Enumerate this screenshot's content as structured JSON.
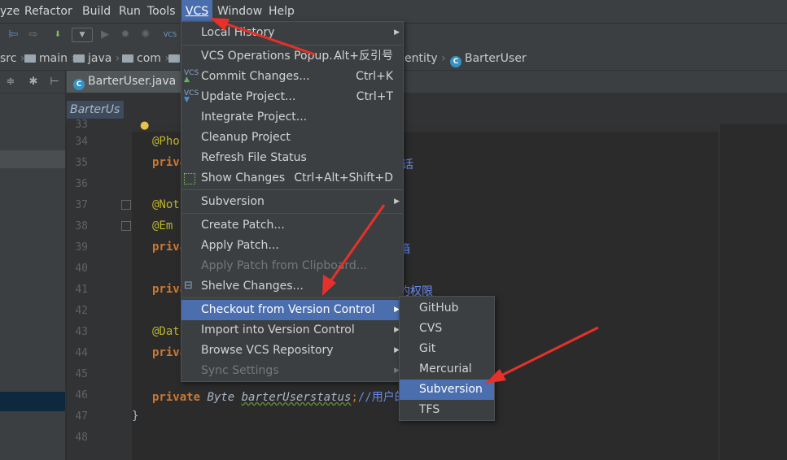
{
  "menubar": {
    "items": [
      "yze",
      "Refactor",
      "Build",
      "Run",
      "Tools",
      "VCS",
      "Window",
      "Help"
    ],
    "active": "VCS"
  },
  "navbar": {
    "crumbs": [
      "src",
      "main",
      "java",
      "com",
      "entity",
      "BarterUser"
    ]
  },
  "editor": {
    "tab_label": "BarterUser.java",
    "breadcrumb_label": "BarterUs",
    "line_numbers": [
      "33",
      "34",
      "35",
      "36",
      "37",
      "38",
      "39",
      "40",
      "41",
      "42",
      "43",
      "44",
      "45",
      "46",
      "47",
      "48"
    ],
    "code": {
      "l34": "@Pho",
      "l35_kw": "priva",
      "l35_tail": "话",
      "l37": "@Not",
      "l38": "@Em",
      "l39_kw": "priva",
      "l39_tail": "箱",
      "l41_kw": "priva",
      "l41_tail": "的权限",
      "l43": "@Dat",
      "l44_kw": "priva",
      "l46_kw": "private",
      "l46_type": "Byte",
      "l46_var": "barterUserstatus",
      "l46_semi": ";",
      "l46_comment": "//用户的状态",
      "l47": "}"
    }
  },
  "vcs_menu": {
    "items": [
      {
        "label": "Local History",
        "shortcut": "",
        "submenu": true
      },
      {
        "label": "VCS Operations Popup...",
        "shortcut": "Alt+反引号"
      },
      {
        "label": "Commit Changes...",
        "shortcut": "Ctrl+K",
        "icon": "vcs-commit-icon"
      },
      {
        "label": "Update Project...",
        "shortcut": "Ctrl+T",
        "icon": "vcs-update-icon"
      },
      {
        "label": "Integrate Project...",
        "shortcut": ""
      },
      {
        "label": "Cleanup Project",
        "shortcut": ""
      },
      {
        "label": "Refresh File Status",
        "shortcut": ""
      },
      {
        "label": "Show Changes",
        "shortcut": "Ctrl+Alt+Shift+D",
        "icon": "show-changes-icon"
      },
      {
        "label": "Subversion",
        "shortcut": "",
        "submenu": true
      },
      {
        "label": "Create Patch...",
        "shortcut": ""
      },
      {
        "label": "Apply Patch...",
        "shortcut": ""
      },
      {
        "label": "Apply Patch from Clipboard...",
        "shortcut": "",
        "disabled": true
      },
      {
        "label": "Shelve Changes...",
        "shortcut": "",
        "icon": "shelve-icon"
      },
      {
        "label": "Checkout from Version Control",
        "shortcut": "",
        "submenu": true,
        "selected": true
      },
      {
        "label": "Import into Version Control",
        "shortcut": "",
        "submenu": true
      },
      {
        "label": "Browse VCS Repository",
        "shortcut": "",
        "submenu": true
      },
      {
        "label": "Sync Settings",
        "shortcut": "",
        "submenu": true,
        "disabled": true
      }
    ]
  },
  "checkout_submenu": {
    "items": [
      {
        "label": "GitHub"
      },
      {
        "label": "CVS"
      },
      {
        "label": "Git"
      },
      {
        "label": "Mercurial"
      },
      {
        "label": "Subversion",
        "selected": true
      },
      {
        "label": "TFS"
      }
    ]
  },
  "colors": {
    "accent": "#4b6eaf",
    "annotation_arrow": "#e8302a"
  }
}
